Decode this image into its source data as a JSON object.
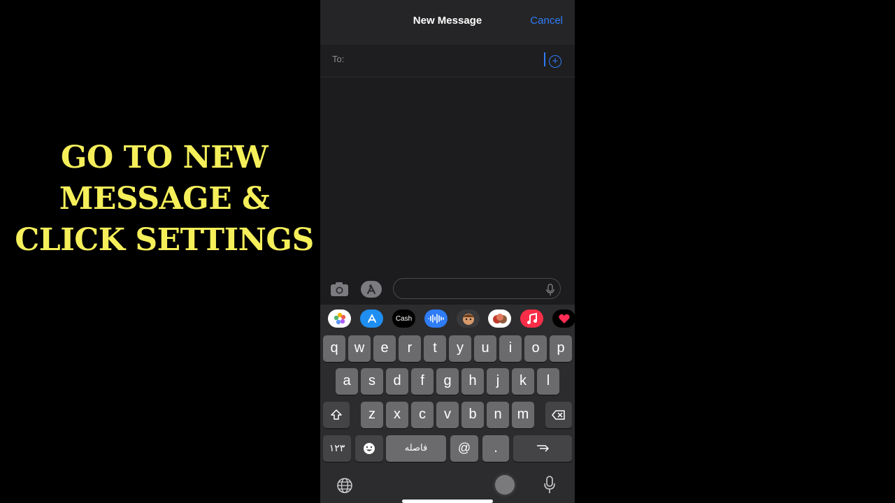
{
  "caption": {
    "line1": "GO TO NEW",
    "line2": "MESSAGE &",
    "line3": "CLICK SETTINGS"
  },
  "nav": {
    "title": "New Message",
    "cancel": "Cancel"
  },
  "to_field": {
    "label": "To:",
    "value": ""
  },
  "compose": {
    "message_value": ""
  },
  "app_strip": [
    {
      "name": "photos-app-icon"
    },
    {
      "name": "app-store-icon"
    },
    {
      "name": "apple-cash-icon",
      "label": "Cash"
    },
    {
      "name": "audio-message-icon"
    },
    {
      "name": "memoji-icon"
    },
    {
      "name": "memoji-stickers-icon"
    },
    {
      "name": "music-app-icon"
    },
    {
      "name": "digital-touch-icon"
    }
  ],
  "keyboard": {
    "row1": [
      "q",
      "w",
      "e",
      "r",
      "t",
      "y",
      "u",
      "i",
      "o",
      "p"
    ],
    "row2": [
      "a",
      "s",
      "d",
      "f",
      "g",
      "h",
      "j",
      "k",
      "l"
    ],
    "row3": [
      "z",
      "x",
      "c",
      "v",
      "b",
      "n",
      "m"
    ],
    "numbers_key": "۱۲۳",
    "space_key": "فاصله",
    "at_key": "@",
    "dot_key": "."
  },
  "colors": {
    "accent": "#2f7cf6",
    "caption": "#f5ef5a"
  }
}
